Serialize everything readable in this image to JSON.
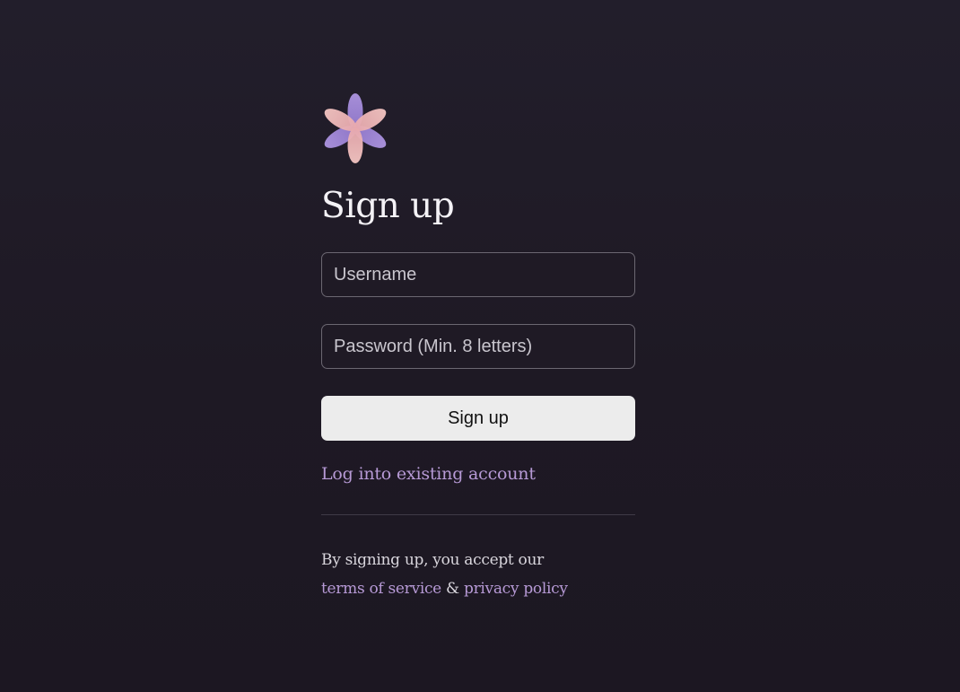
{
  "colors": {
    "background": "#1e1924",
    "accent_link": "#b79ad6",
    "button_background": "#ececec",
    "field_border": "#6b6771"
  },
  "logo": {
    "icon": "flower-logo-icon"
  },
  "form": {
    "title": "Sign up",
    "username_placeholder": "Username",
    "password_placeholder": "Password (Min. 8 letters)",
    "submit_label": "Sign up"
  },
  "login_link": "Log into existing account",
  "footer": {
    "terms_prefix": "By signing up, you accept our",
    "terms_link": "terms of service",
    "conjunction": "&",
    "privacy_link": "privacy policy"
  }
}
